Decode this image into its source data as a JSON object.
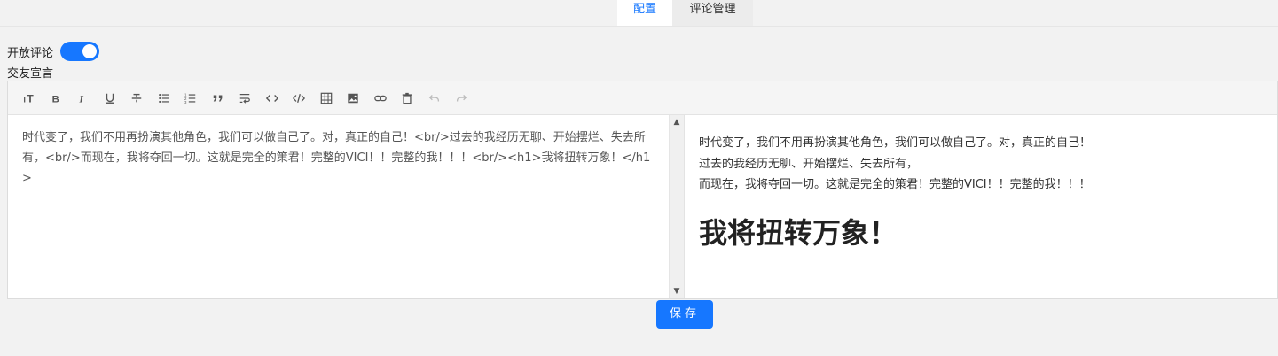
{
  "tabs": {
    "config": "配置",
    "comments": "评论管理"
  },
  "settings": {
    "open_comments_label": "开放评论",
    "open_comments_on": true,
    "declaration_label": "交友宣言"
  },
  "toolbar": {
    "icons": [
      "heading-icon",
      "bold-icon",
      "italic-icon",
      "underline-icon",
      "strikethrough-icon",
      "bullet-list-icon",
      "ordered-list-icon",
      "quote-icon",
      "line-break-icon",
      "inline-code-icon",
      "code-block-icon",
      "table-icon",
      "image-icon",
      "link-icon",
      "delete-icon",
      "undo-icon",
      "redo-icon"
    ]
  },
  "editor": {
    "source_text": "时代变了，我们不用再扮演其他角色，我们可以做自己了。对，真正的自己！<br/>过去的我经历无聊、开始摆烂、失去所有，<br/>而现在，我将夺回一切。这就是完全的策君！完整的VICI！！完整的我！！！<br/><h1>我将扭转万象！</h1>",
    "preview_line1": "时代变了，我们不用再扮演其他角色，我们可以做自己了。对，真正的自己！",
    "preview_line2": "过去的我经历无聊、开始摆烂、失去所有，",
    "preview_line3": "而现在，我将夺回一切。这就是完全的策君！完整的VICI！！完整的我！！！",
    "preview_heading": "我将扭转万象！"
  },
  "actions": {
    "save_label": "保存"
  },
  "colors": {
    "accent": "#1677ff",
    "background": "#f2f2f2"
  }
}
